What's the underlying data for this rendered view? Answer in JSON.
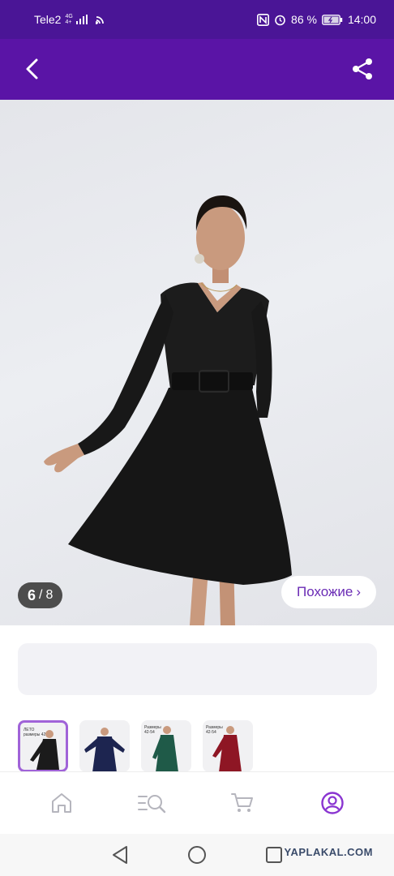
{
  "statusbar": {
    "carrier": "Tele2",
    "network": "4G",
    "network_sub": "4+",
    "battery_percent": "86 %",
    "time": "14:00"
  },
  "appbar": {
    "back_icon": "chevron-left-icon",
    "share_icon": "share-icon",
    "background_color": "#5a14a6"
  },
  "gallery": {
    "current": "6",
    "separator": "/",
    "total": "8",
    "similar_label": "Похожие",
    "similar_chevron": "›"
  },
  "thumbnails": [
    {
      "tag_line1": "ЛЕТО",
      "tag_line2": "размеры 42-54",
      "dress_color": "#1b1b1b",
      "selected": true
    },
    {
      "tag_line1": "",
      "tag_line2": "",
      "dress_color": "#1d2550",
      "selected": false
    },
    {
      "tag_line1": "Размеры",
      "tag_line2": "42-54",
      "dress_color": "#1f5a48",
      "selected": false
    },
    {
      "tag_line1": "Размеры",
      "tag_line2": "42-54",
      "dress_color": "#8e1624",
      "selected": false
    }
  ],
  "bottomnav": {
    "items": [
      "home-icon",
      "catalog-search-icon",
      "cart-icon",
      "profile-icon"
    ],
    "active": "profile-icon",
    "accent": "#8a35d1"
  },
  "sysnav": {
    "items": [
      "back-triangle-icon",
      "home-circle-icon",
      "recents-square-icon"
    ]
  },
  "watermark": "YAPLAKAL.COM"
}
